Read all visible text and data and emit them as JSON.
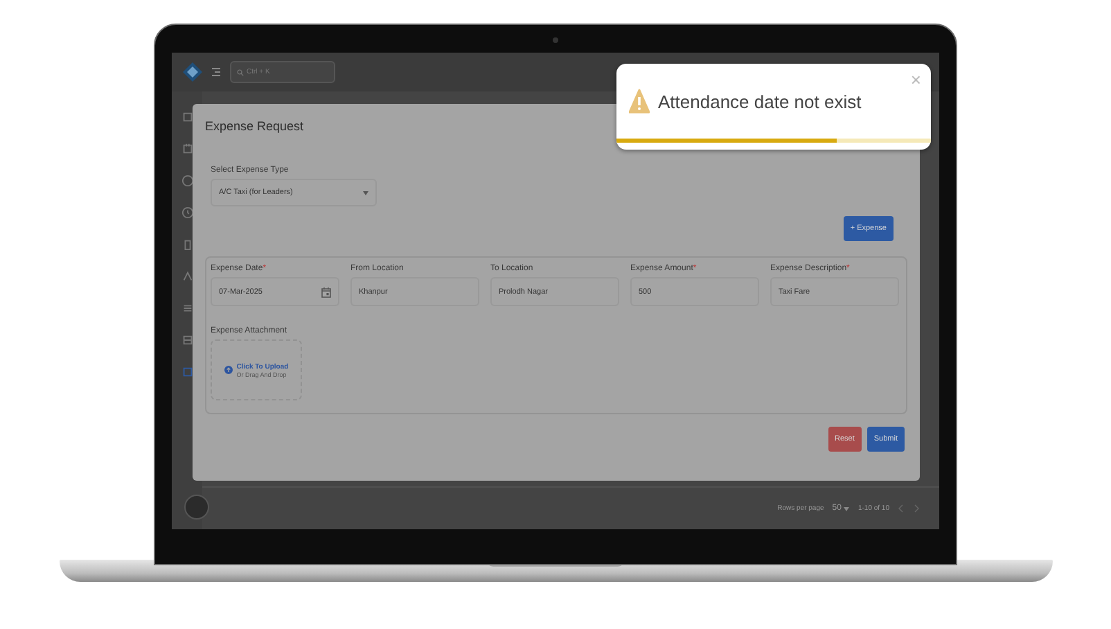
{
  "app": {
    "search": {
      "placeholder": "Ctrl + K"
    },
    "sidebar": {
      "items": [
        {
          "selected": false
        },
        {
          "selected": false
        },
        {
          "selected": false
        },
        {
          "selected": false
        },
        {
          "selected": false
        },
        {
          "selected": false
        },
        {
          "selected": false
        },
        {
          "selected": false
        },
        {
          "selected": true
        }
      ]
    },
    "footer": {
      "rows_label": "Rows per page",
      "rows_value": "50",
      "range": "1-10 of 10"
    }
  },
  "modal": {
    "title": "Expense Request",
    "expense_type": {
      "label": "Select Expense Type",
      "value": "A/C Taxi (for Leaders)"
    },
    "add_button": "+ Expense",
    "fields": [
      {
        "kind": "date",
        "label": "Expense Date",
        "required_mark": "*",
        "value": "07-Mar-2025"
      },
      {
        "kind": "text",
        "label": "From Location",
        "value": "Khanpur"
      },
      {
        "kind": "text",
        "label": "To Location",
        "value": "Prolodh Nagar"
      },
      {
        "kind": "text",
        "label": "Expense Amount",
        "required_mark": "*",
        "value": "500"
      },
      {
        "kind": "text",
        "label": "Expense Description",
        "required_mark": "*",
        "value": "Taxi Fare"
      }
    ],
    "attachment": {
      "label": "Expense Attachment",
      "link": "Click To Upload",
      "hint": "Or Drag And Drop"
    },
    "actions": [
      {
        "kind": "reset",
        "label": "Reset"
      },
      {
        "kind": "submit",
        "label": "Submit"
      }
    ]
  },
  "toast": {
    "message": "Attendance date not exist",
    "close": "×",
    "level": 0.7
  }
}
